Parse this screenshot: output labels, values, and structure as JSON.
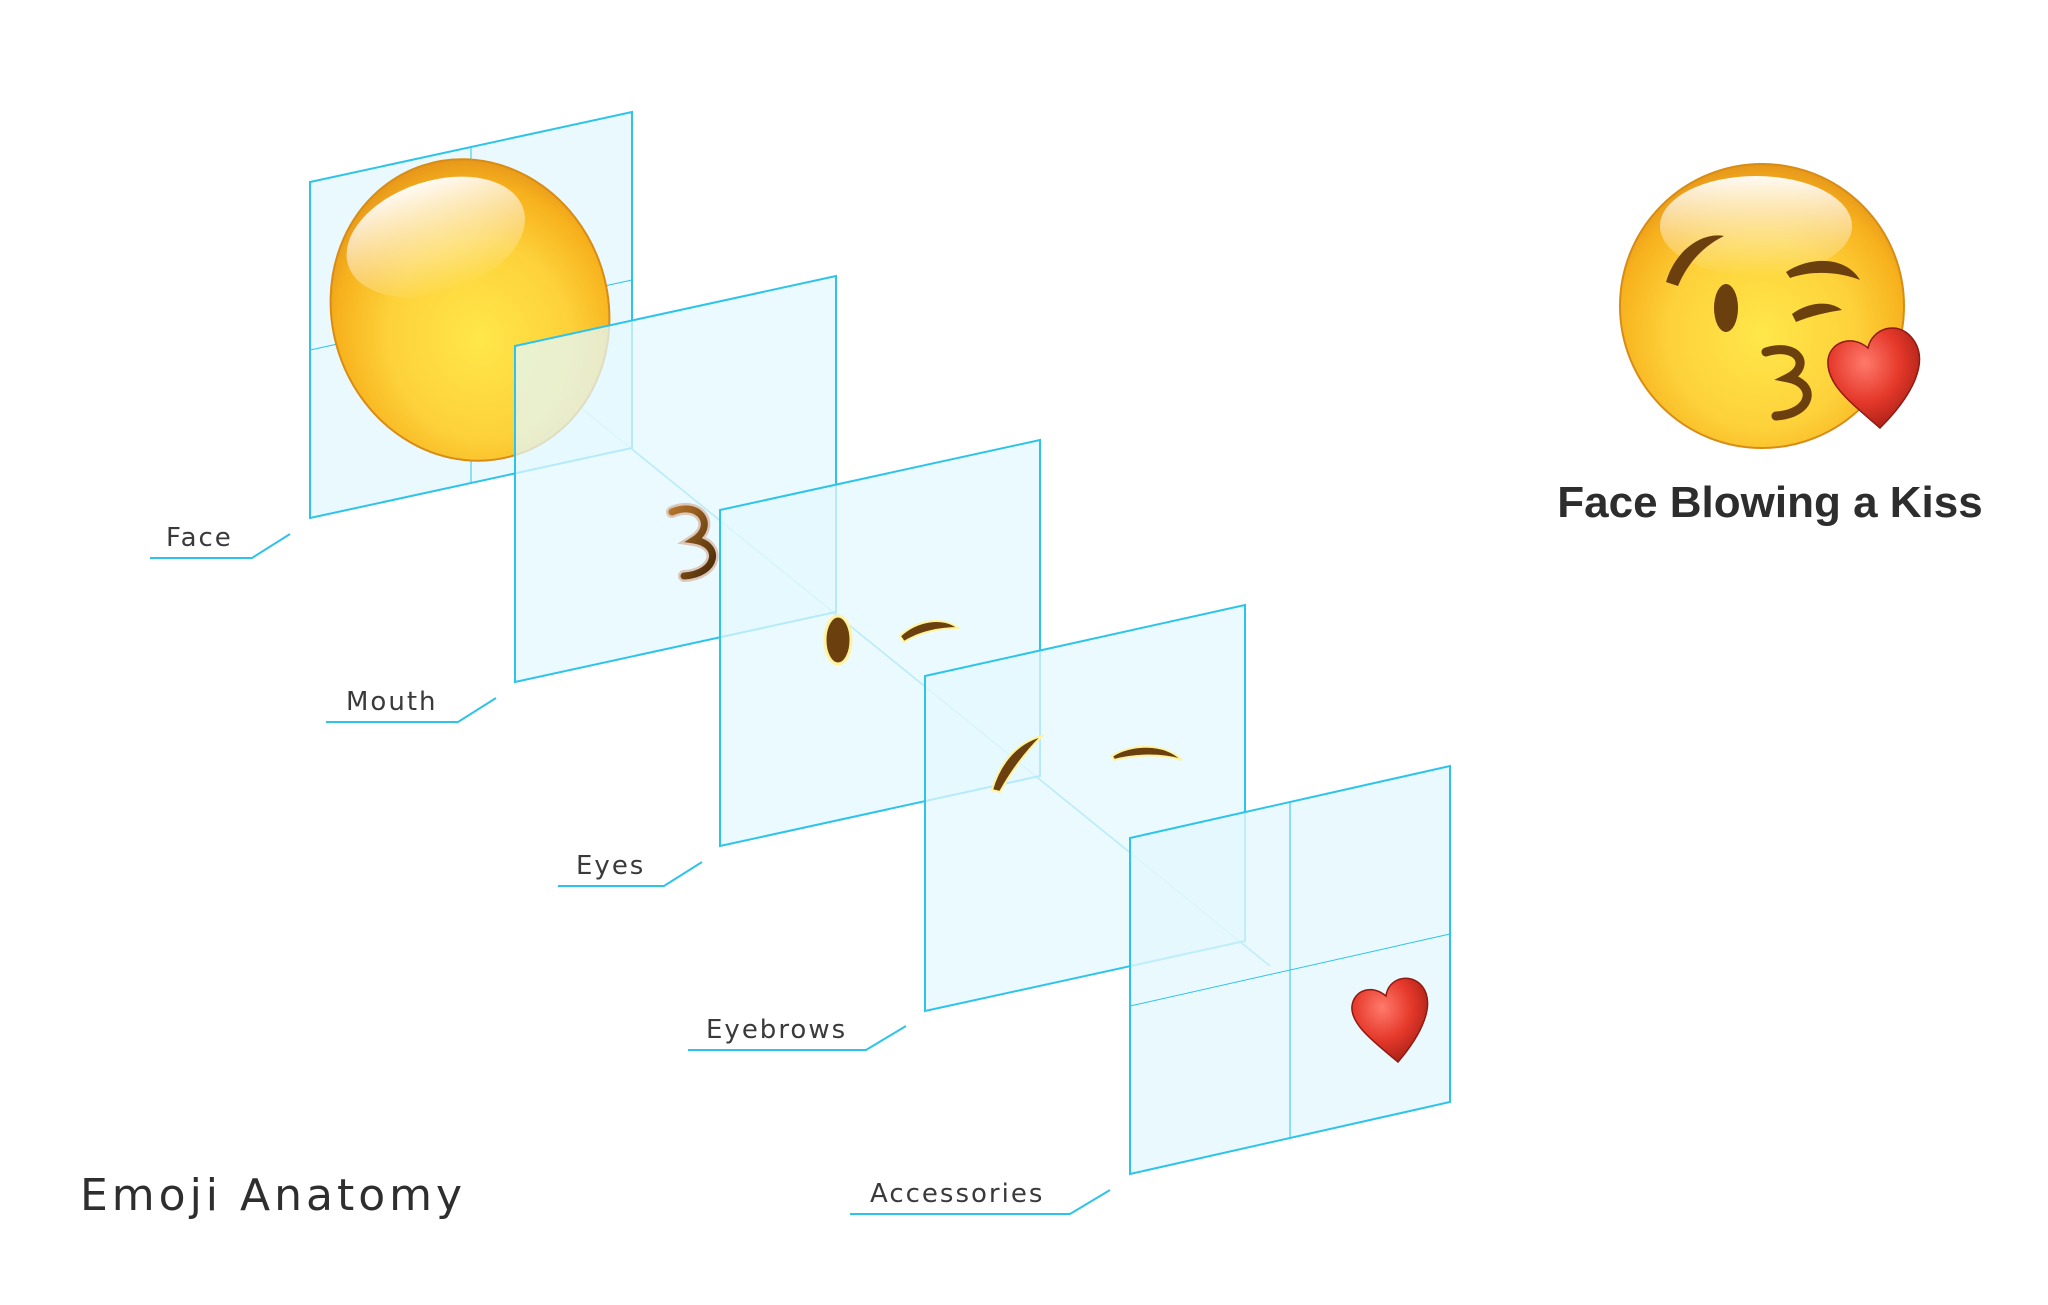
{
  "title": "Emoji Anatomy",
  "emoji": {
    "name": "Face Blowing a Kiss"
  },
  "layers": [
    {
      "label": "Face"
    },
    {
      "label": "Mouth"
    },
    {
      "label": "Eyes"
    },
    {
      "label": "Eyebrows"
    },
    {
      "label": "Accessories"
    }
  ],
  "colors": {
    "plane_stroke": "#2ec4ea",
    "plane_fill": "#e3f8fd",
    "face_yellow": "#fbc02d",
    "feature_brown": "#6b3f0e",
    "heart_red": "#e53935"
  }
}
